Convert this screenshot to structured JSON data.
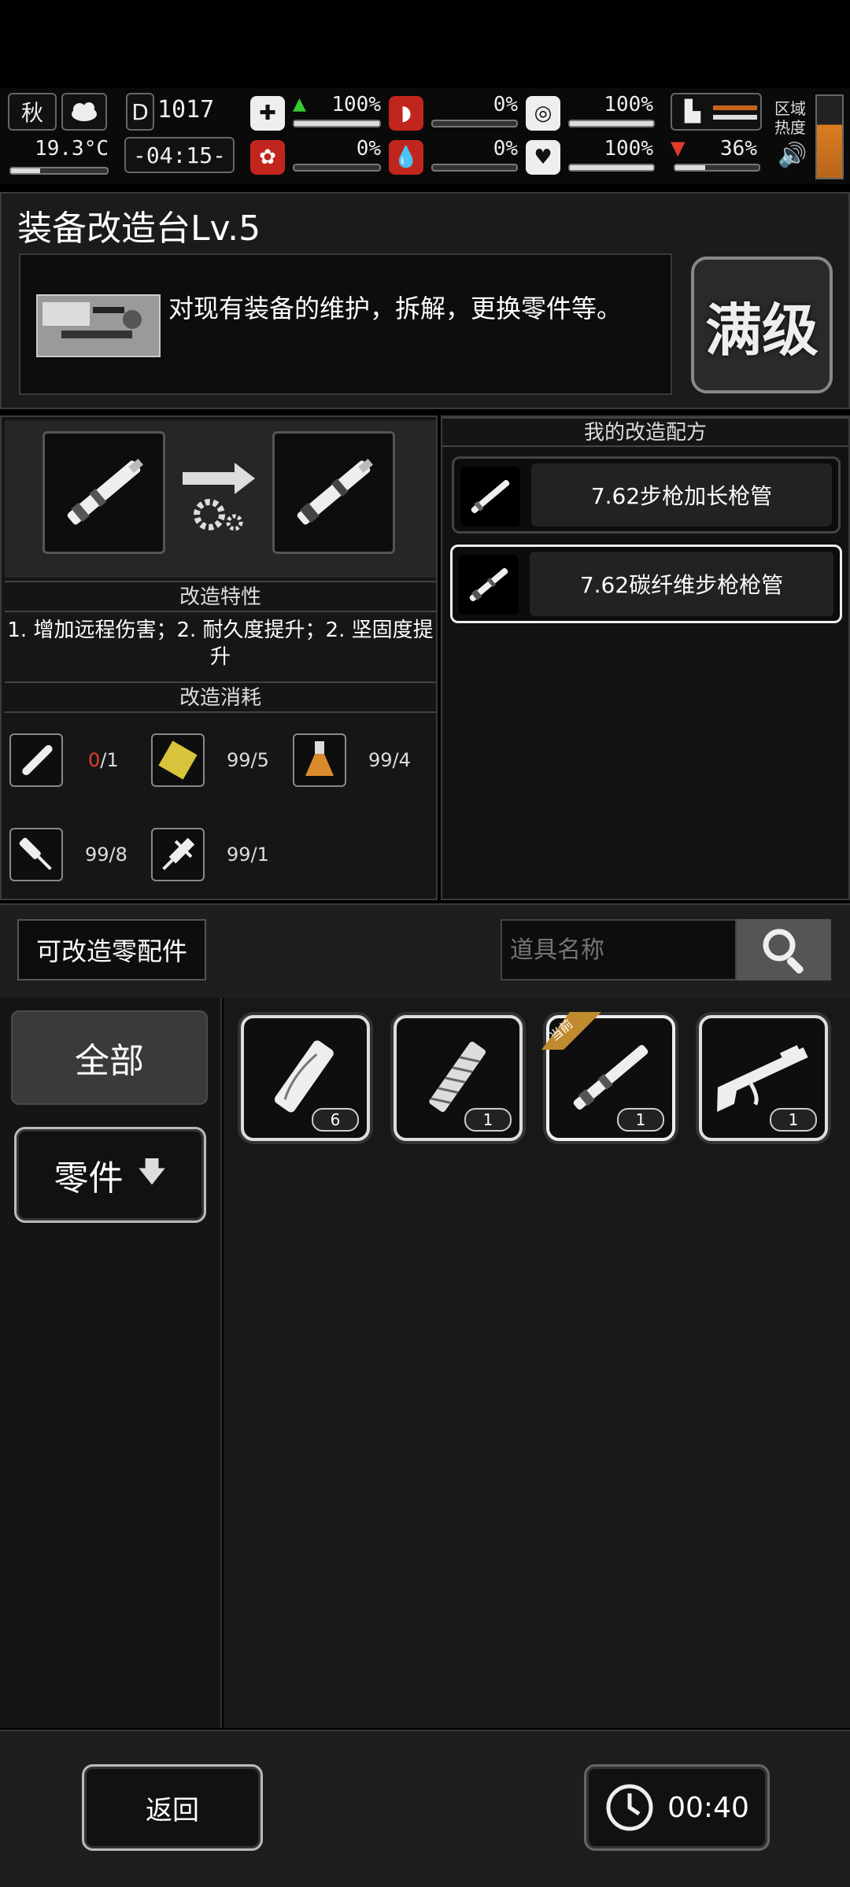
{
  "hud": {
    "season": "秋",
    "temperature": "19.3°C",
    "day": "1017",
    "time": "-04:15-",
    "stats": {
      "health": "100%",
      "hunger": "0%",
      "thirst_top": "100%",
      "stamina": "",
      "mind": "0%",
      "blood": "0%",
      "mood": "100%",
      "weight": "36%"
    },
    "region_heat_label_1": "区域",
    "region_heat_label_2": "热度"
  },
  "title": "装备改造台Lv.5",
  "description": "对现有装备的维护，拆解，更换零件等。",
  "max_level_button": "满级",
  "traits_header": "改造特性",
  "traits_text": "1. 增加远程伤害；2. 耐久度提升；2. 坚固度提升",
  "cost_header": "改造消耗",
  "costs": [
    {
      "icon": "pipe-icon",
      "have": "0",
      "need": "/1",
      "short": true
    },
    {
      "icon": "gold-plate-icon",
      "text": "99/5"
    },
    {
      "icon": "flask-icon",
      "text": "99/4"
    },
    {
      "icon": "knife-part-icon",
      "text": "99/8"
    },
    {
      "icon": "syringe-icon",
      "text": "99/1"
    }
  ],
  "recipes_header": "我的改造配方",
  "recipes": [
    {
      "name": "7.62步枪加长枪管",
      "selected": false
    },
    {
      "name": "7.62碳纤维步枪枪管",
      "selected": true
    }
  ],
  "modifiable_label": "可改造零配件",
  "search_placeholder": "道具名称",
  "categories": [
    {
      "label": "全部"
    },
    {
      "label": "零件",
      "arrow": "🡇"
    }
  ],
  "inventory": [
    {
      "icon": "wood-log-icon",
      "count": "6"
    },
    {
      "icon": "suppressor-icon",
      "count": "1"
    },
    {
      "icon": "rifle-barrel-icon",
      "count": "1",
      "badge": "当前"
    },
    {
      "icon": "rifle-stock-icon",
      "count": "1"
    }
  ],
  "back_button": "返回",
  "timer": "00:40",
  "colors": {
    "accent_gold": "#c08a2e",
    "cost_insufficient": "#e23b2e",
    "health_up": "#33cc33"
  }
}
